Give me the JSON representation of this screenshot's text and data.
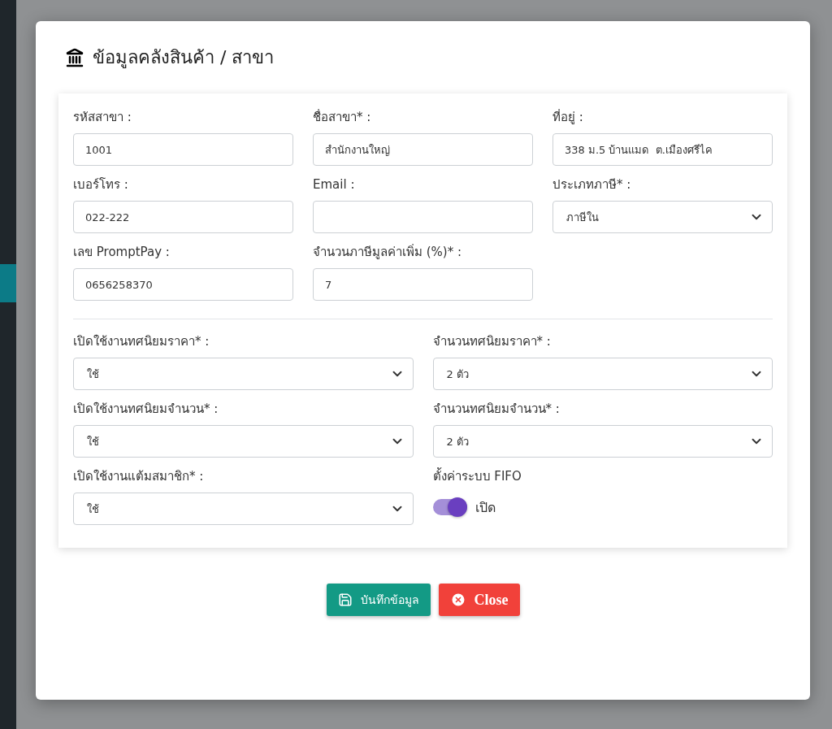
{
  "dialog": {
    "title": "ข้อมูลคลังสินค้า / สาขา",
    "top_fields": [
      {
        "kind": "input",
        "label": "รหัสสาขา :",
        "value": "1001"
      },
      {
        "kind": "input",
        "label": "ชื่อสาขา* :",
        "value": "สำนักงานใหญ่"
      },
      {
        "kind": "input",
        "label": "ที่อยู่ :",
        "value": "338 ม.5 บ้านแมด  ต.เมืองศรีไค"
      },
      {
        "kind": "input",
        "label": "เบอร์โทร :",
        "value": "022-222"
      },
      {
        "kind": "input",
        "label": "Email :"
      },
      {
        "kind": "select",
        "label": "ประเภทภาษี* :",
        "value": "ภาษีใน"
      },
      {
        "kind": "input",
        "label": "เลข PromptPay :",
        "value": "0656258370"
      },
      {
        "kind": "input",
        "label": "จำนวนภาษีมูลค่าเพิ่ม (%)* :",
        "value": "7"
      }
    ],
    "bottom_fields": [
      {
        "kind": "select",
        "label": "เปิดใช้งานทศนิยมราคา* :",
        "value": "ใช้"
      },
      {
        "kind": "select",
        "label": "จำนวนทศนิยมราคา* :",
        "value": "2 ตัว"
      },
      {
        "kind": "select",
        "label": "เปิดใช้งานทศนิยมจำนวน* :",
        "value": "ใช้"
      },
      {
        "kind": "select",
        "label": "จำนวนทศนิยมจำนวน* :",
        "value": "2 ตัว"
      },
      {
        "kind": "select",
        "label": "เปิดใช้งานแต้มสมาชิก* :",
        "value": "ใช้"
      },
      {
        "kind": "toggle",
        "label": "ตั้งค่าระบบ FIFO",
        "on": true,
        "text": "เปิด"
      }
    ],
    "buttons": [
      {
        "kind": "save",
        "label": "บันทึกข้อมูล"
      },
      {
        "kind": "close",
        "label": "Close"
      }
    ]
  }
}
